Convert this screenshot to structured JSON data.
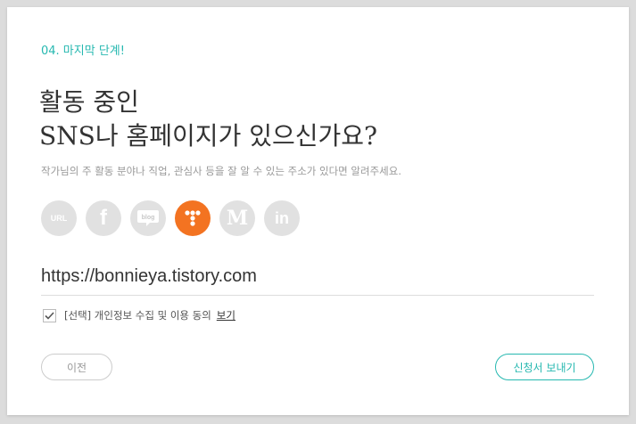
{
  "step": {
    "label": "04. 마지막 단계!"
  },
  "headline": {
    "line1": "활동 중인",
    "line2": "SNS나 홈페이지가 있으신가요?"
  },
  "subtext": "작가님의 주 활동 분야나 직업, 관심사 등을 잘 알 수 있는 주소가 있다면 알려주세요.",
  "sns": {
    "items": [
      {
        "name": "url",
        "label": "URL",
        "selected": false
      },
      {
        "name": "facebook",
        "label": "f",
        "selected": false
      },
      {
        "name": "blog",
        "label": "blog",
        "selected": false
      },
      {
        "name": "tistory",
        "label": "tistory",
        "selected": true
      },
      {
        "name": "medium",
        "label": "M",
        "selected": false
      },
      {
        "name": "linkedin",
        "label": "in",
        "selected": false
      }
    ],
    "active_color": "#f37321",
    "inactive_color": "#e1e1e1"
  },
  "url_input": {
    "value": "https://bonnieya.tistory.com"
  },
  "agreement": {
    "checked": true,
    "label": "[선택] 개인정보 수집 및 이용 동의",
    "link": "보기"
  },
  "buttons": {
    "prev": "이전",
    "submit": "신청서 보내기"
  },
  "colors": {
    "accent": "#26b8b0"
  }
}
